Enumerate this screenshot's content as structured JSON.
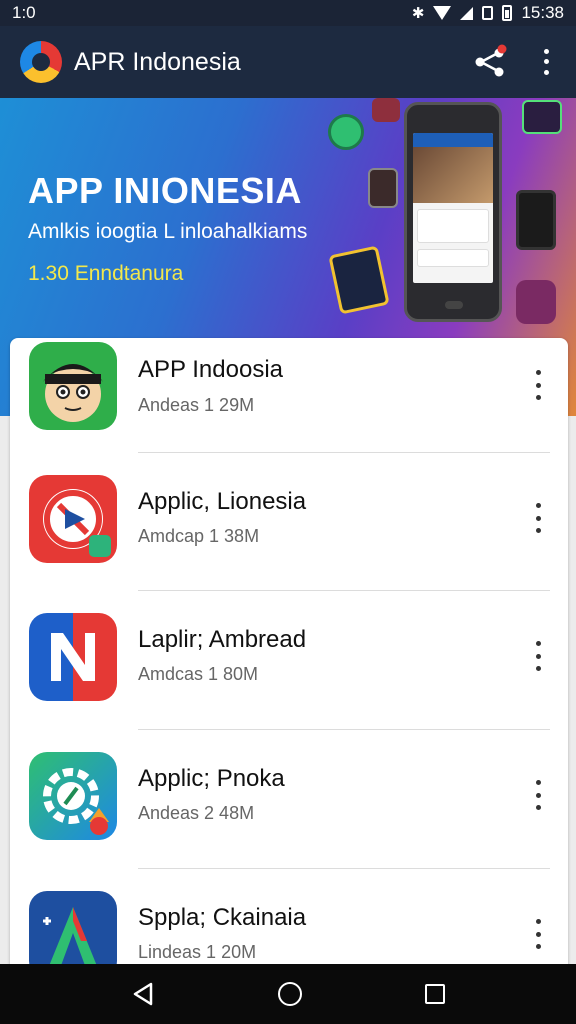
{
  "status_bar": {
    "left_text": "1:0",
    "time": "15:38",
    "icons": [
      "bluetooth-icon",
      "wifi-icon",
      "signal-icon",
      "sim-icon",
      "battery-icon"
    ]
  },
  "app_bar": {
    "title": "APR Indonesia",
    "background": "#1d2a40",
    "actions": [
      "share-icon",
      "more-vert-icon"
    ]
  },
  "banner": {
    "title": "APP INIONESIA",
    "subtitle": "Amlkis ioogtia L inloahalkiams",
    "version": "1.30 Enndtanura"
  },
  "apps": [
    {
      "name": "APP Indoosia",
      "meta": "Andeas 1 29M",
      "icon": "cartoon-face-icon"
    },
    {
      "name": "Applic, Lionesia",
      "meta": "Amdcap 1 38M",
      "icon": "blocked-app-icon"
    },
    {
      "name": "Laplir; Ambread",
      "meta": "Amdcas 1 80M",
      "icon": "letter-n-icon"
    },
    {
      "name": "Applic; Pnoka",
      "meta": "Andeas 2 48M",
      "icon": "compass-gear-icon"
    },
    {
      "name": "Sppla; Ckainaia",
      "meta": "Lindeas 1 20M",
      "icon": "letter-a-icon"
    }
  ],
  "nav_bar": {
    "buttons": [
      "back-icon",
      "home-icon",
      "recent-apps-icon"
    ]
  }
}
